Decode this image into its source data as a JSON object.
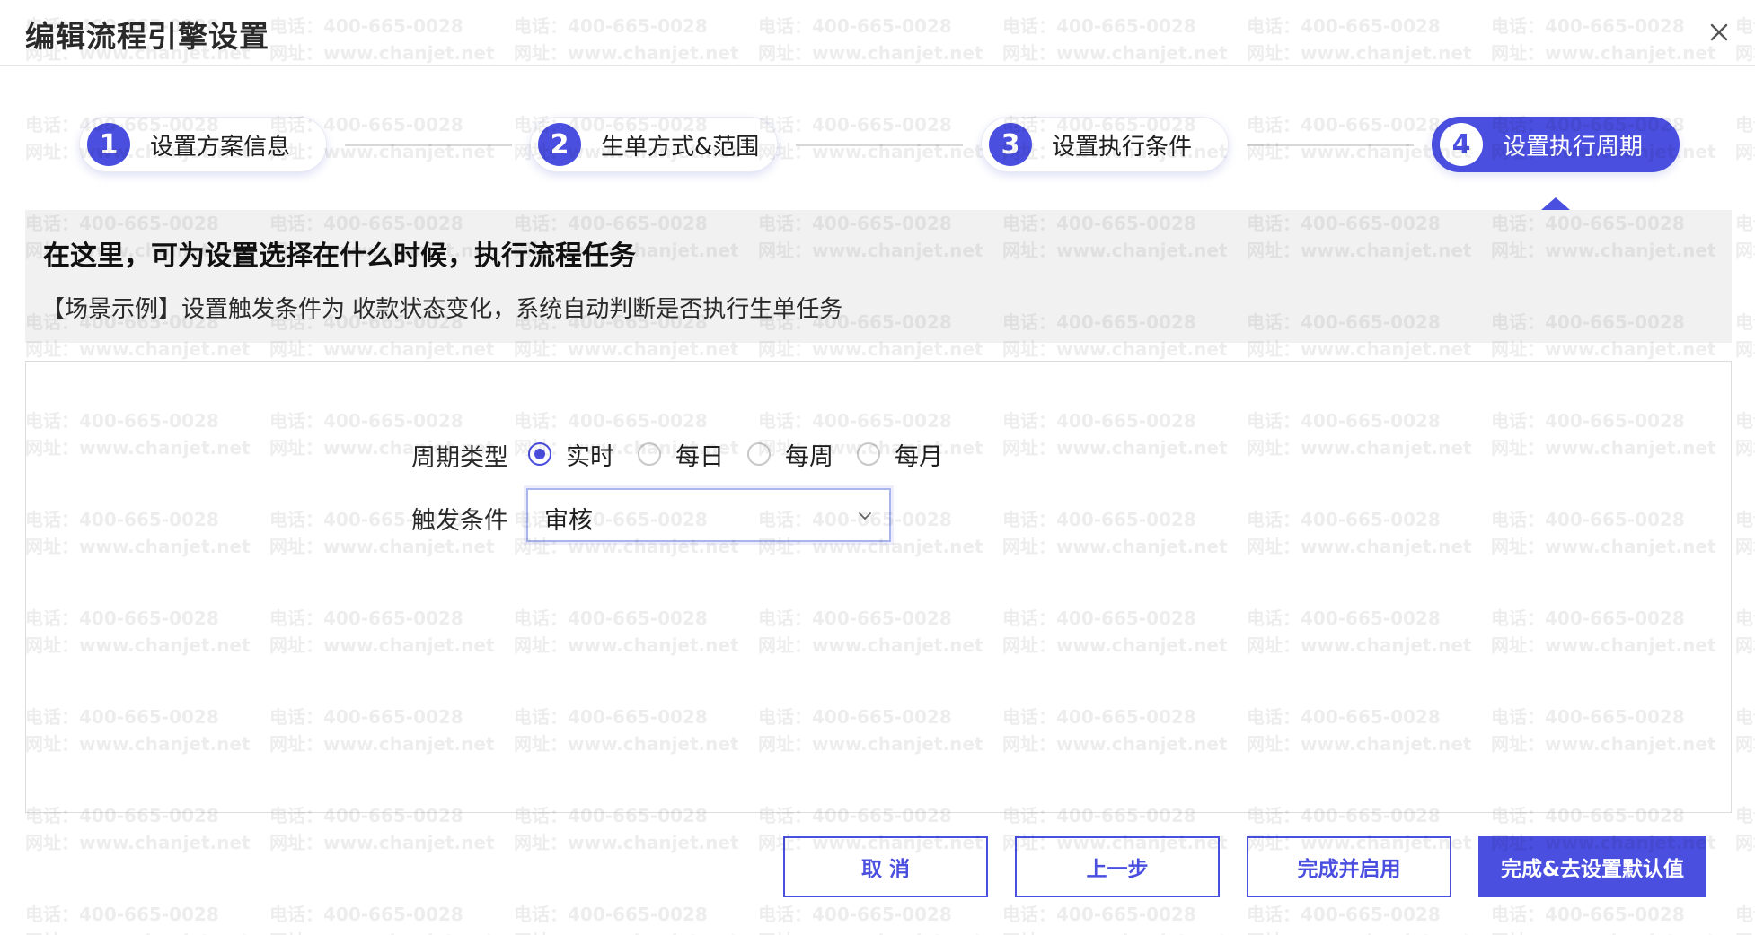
{
  "dialog": {
    "title": "编辑流程引擎设置"
  },
  "steps": [
    {
      "number": "1",
      "label": "设置方案信息",
      "active": false
    },
    {
      "number": "2",
      "label": "生单方式&范围",
      "active": false
    },
    {
      "number": "3",
      "label": "设置执行条件",
      "active": false
    },
    {
      "number": "4",
      "label": "设置执行周期",
      "active": true
    }
  ],
  "info": {
    "title": "在这里，可为设置选择在什么时候，执行流程任务",
    "desc": "【场景示例】设置触发条件为 收款状态变化，系统自动判断是否执行生单任务"
  },
  "form": {
    "period_type_label": "周期类型",
    "period_options": [
      "实时",
      "每日",
      "每周",
      "每月"
    ],
    "period_selected": "实时",
    "trigger_label": "触发条件",
    "trigger_value": "审核"
  },
  "footer": {
    "cancel_label": "取 消",
    "prev_label": "上一步",
    "finish_enable_label": "完成并启用",
    "finish_default_label": "完成&去设置默认值"
  },
  "watermark": {
    "phone": "电话：400-665-0028",
    "site": "网址：www.chanjet.net"
  },
  "colors": {
    "accent": "#4a4fe0",
    "panel_bg": "#f1f1f1"
  },
  "icons": {
    "close": "close-icon",
    "select_arrow": "chevron-down-icon",
    "radio": "radio-icon"
  }
}
